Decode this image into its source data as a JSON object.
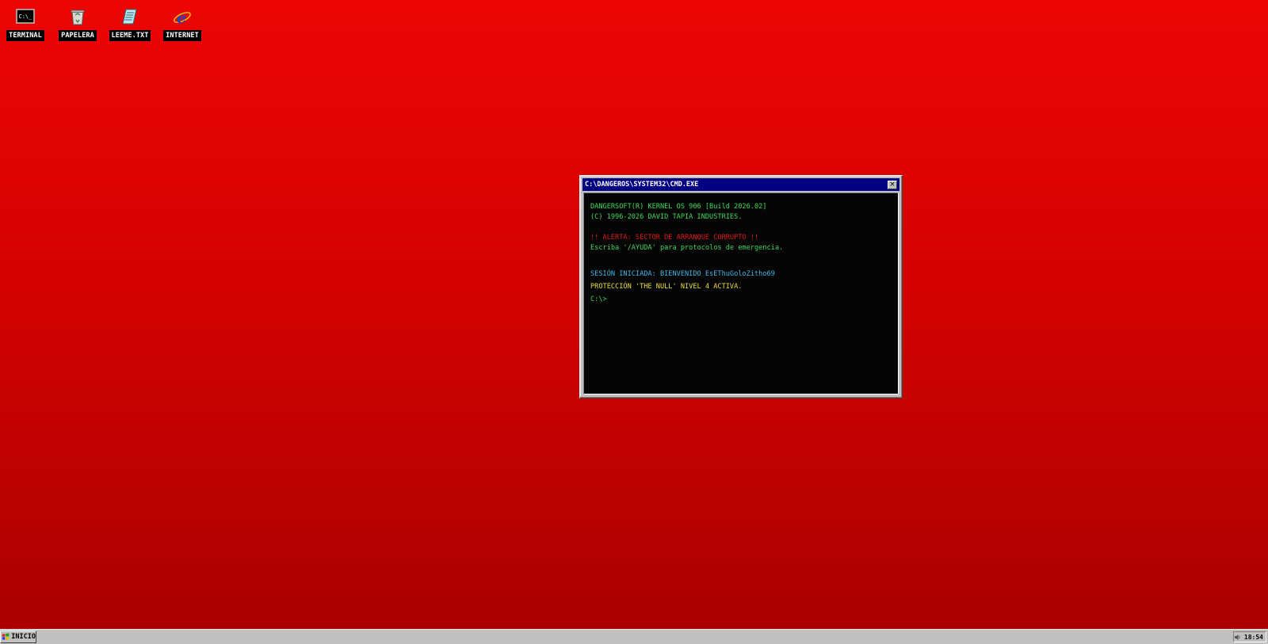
{
  "desktop": {
    "icons": [
      {
        "label": "TERMINAL",
        "icon": "terminal-icon",
        "glyph": "C:\\_"
      },
      {
        "label": "PAPELERA",
        "icon": "recycle-bin-icon"
      },
      {
        "label": "LEEME.TXT",
        "icon": "text-file-icon"
      },
      {
        "label": "INTERNET",
        "icon": "internet-explorer-icon",
        "glyph": "e"
      }
    ]
  },
  "window": {
    "title": "C:\\DANGEROS\\SYSTEM32\\CMD.EXE",
    "close_label": "×",
    "lines": [
      {
        "text": "DANGERSOFT(R) KERNEL OS 906 [Build 2026.02]",
        "color": "#3fd85a"
      },
      {
        "text": "(C) 1996-2026 DAVID TAPIA INDUSTRIES.",
        "color": "#3fd85a"
      },
      {
        "text": "!! ALERTA: SECTOR DE ARRANQUE CORRUPTO !!",
        "color": "#e01b1b"
      },
      {
        "text": "Escriba '/AYUDA' para protocolos de emergencia.",
        "color": "#3fd85a"
      },
      {
        "text": "SESIÓN INICIADA: BIENVENIDO EsEThuGoloZitho69",
        "color": "#3fb6e6"
      },
      {
        "text": "PROTECCIÓN 'THE NULL' NIVEL 4 ACTIVA.",
        "color": "#e8df3a"
      },
      {
        "text": "C:\\>",
        "color": "#3fd85a"
      }
    ]
  },
  "taskbar": {
    "start_label": "INICIO",
    "clock": "18:54",
    "tray_icon": "speaker-icon"
  },
  "colors": {
    "desktop_top": "#ec0505",
    "desktop_bottom": "#a80000",
    "titlebar": "#000080"
  }
}
